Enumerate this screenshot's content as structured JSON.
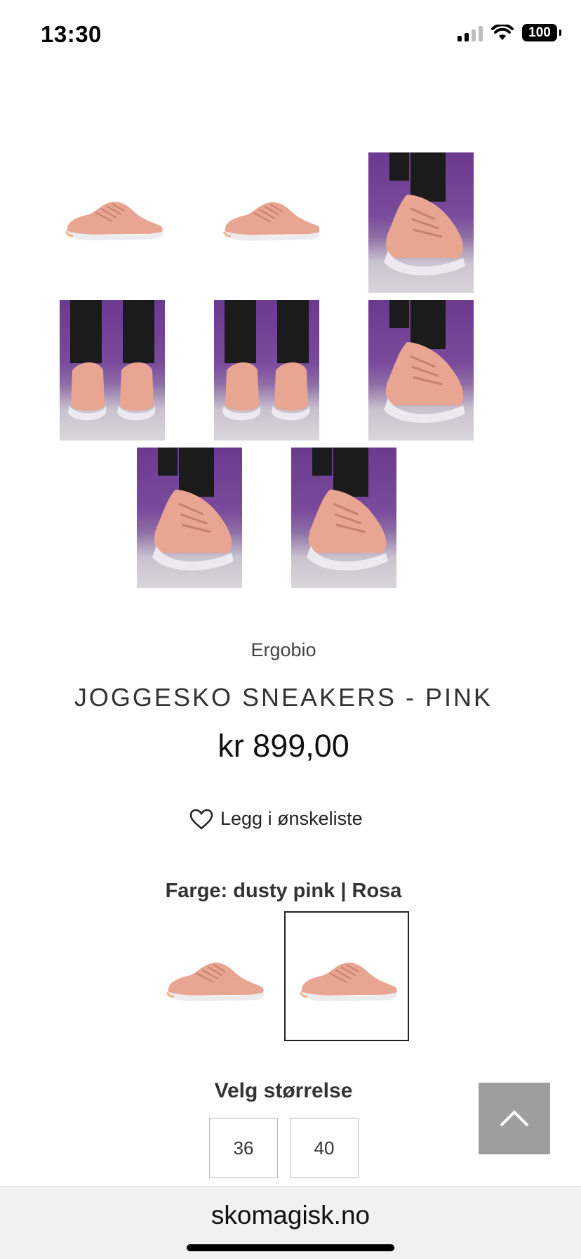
{
  "status_bar": {
    "time": "13:30",
    "battery": "100",
    "icons": [
      "signal-icon",
      "wifi-icon",
      "battery-icon"
    ]
  },
  "gallery": {
    "images": [
      "sneaker-side-view",
      "sneaker-side-view-2",
      "sneaker-on-foot-purple",
      "sneaker-back-view-purple",
      "sneaker-heels-purple",
      "sneaker-front-purple",
      "sneaker-on-foot-purple-2",
      "sneaker-on-foot-purple-3"
    ]
  },
  "product": {
    "brand": "Ergobio",
    "title": "JOGGESKO SNEAKERS - PINK",
    "price": "kr 899,00"
  },
  "wishlist": {
    "label": "Legg i ønskeliste"
  },
  "color": {
    "label": "Farge:  dusty pink | Rosa"
  },
  "size": {
    "label": "Velg størrelse",
    "options": [
      "36",
      "40"
    ]
  },
  "browser": {
    "url": "skomagisk.no"
  },
  "colors": {
    "shoe_pink": "#e8a592",
    "shoe_sole": "#e9e9ec",
    "background_purple": "#6b3a8f",
    "scroll_button": "#9e9e9e"
  }
}
